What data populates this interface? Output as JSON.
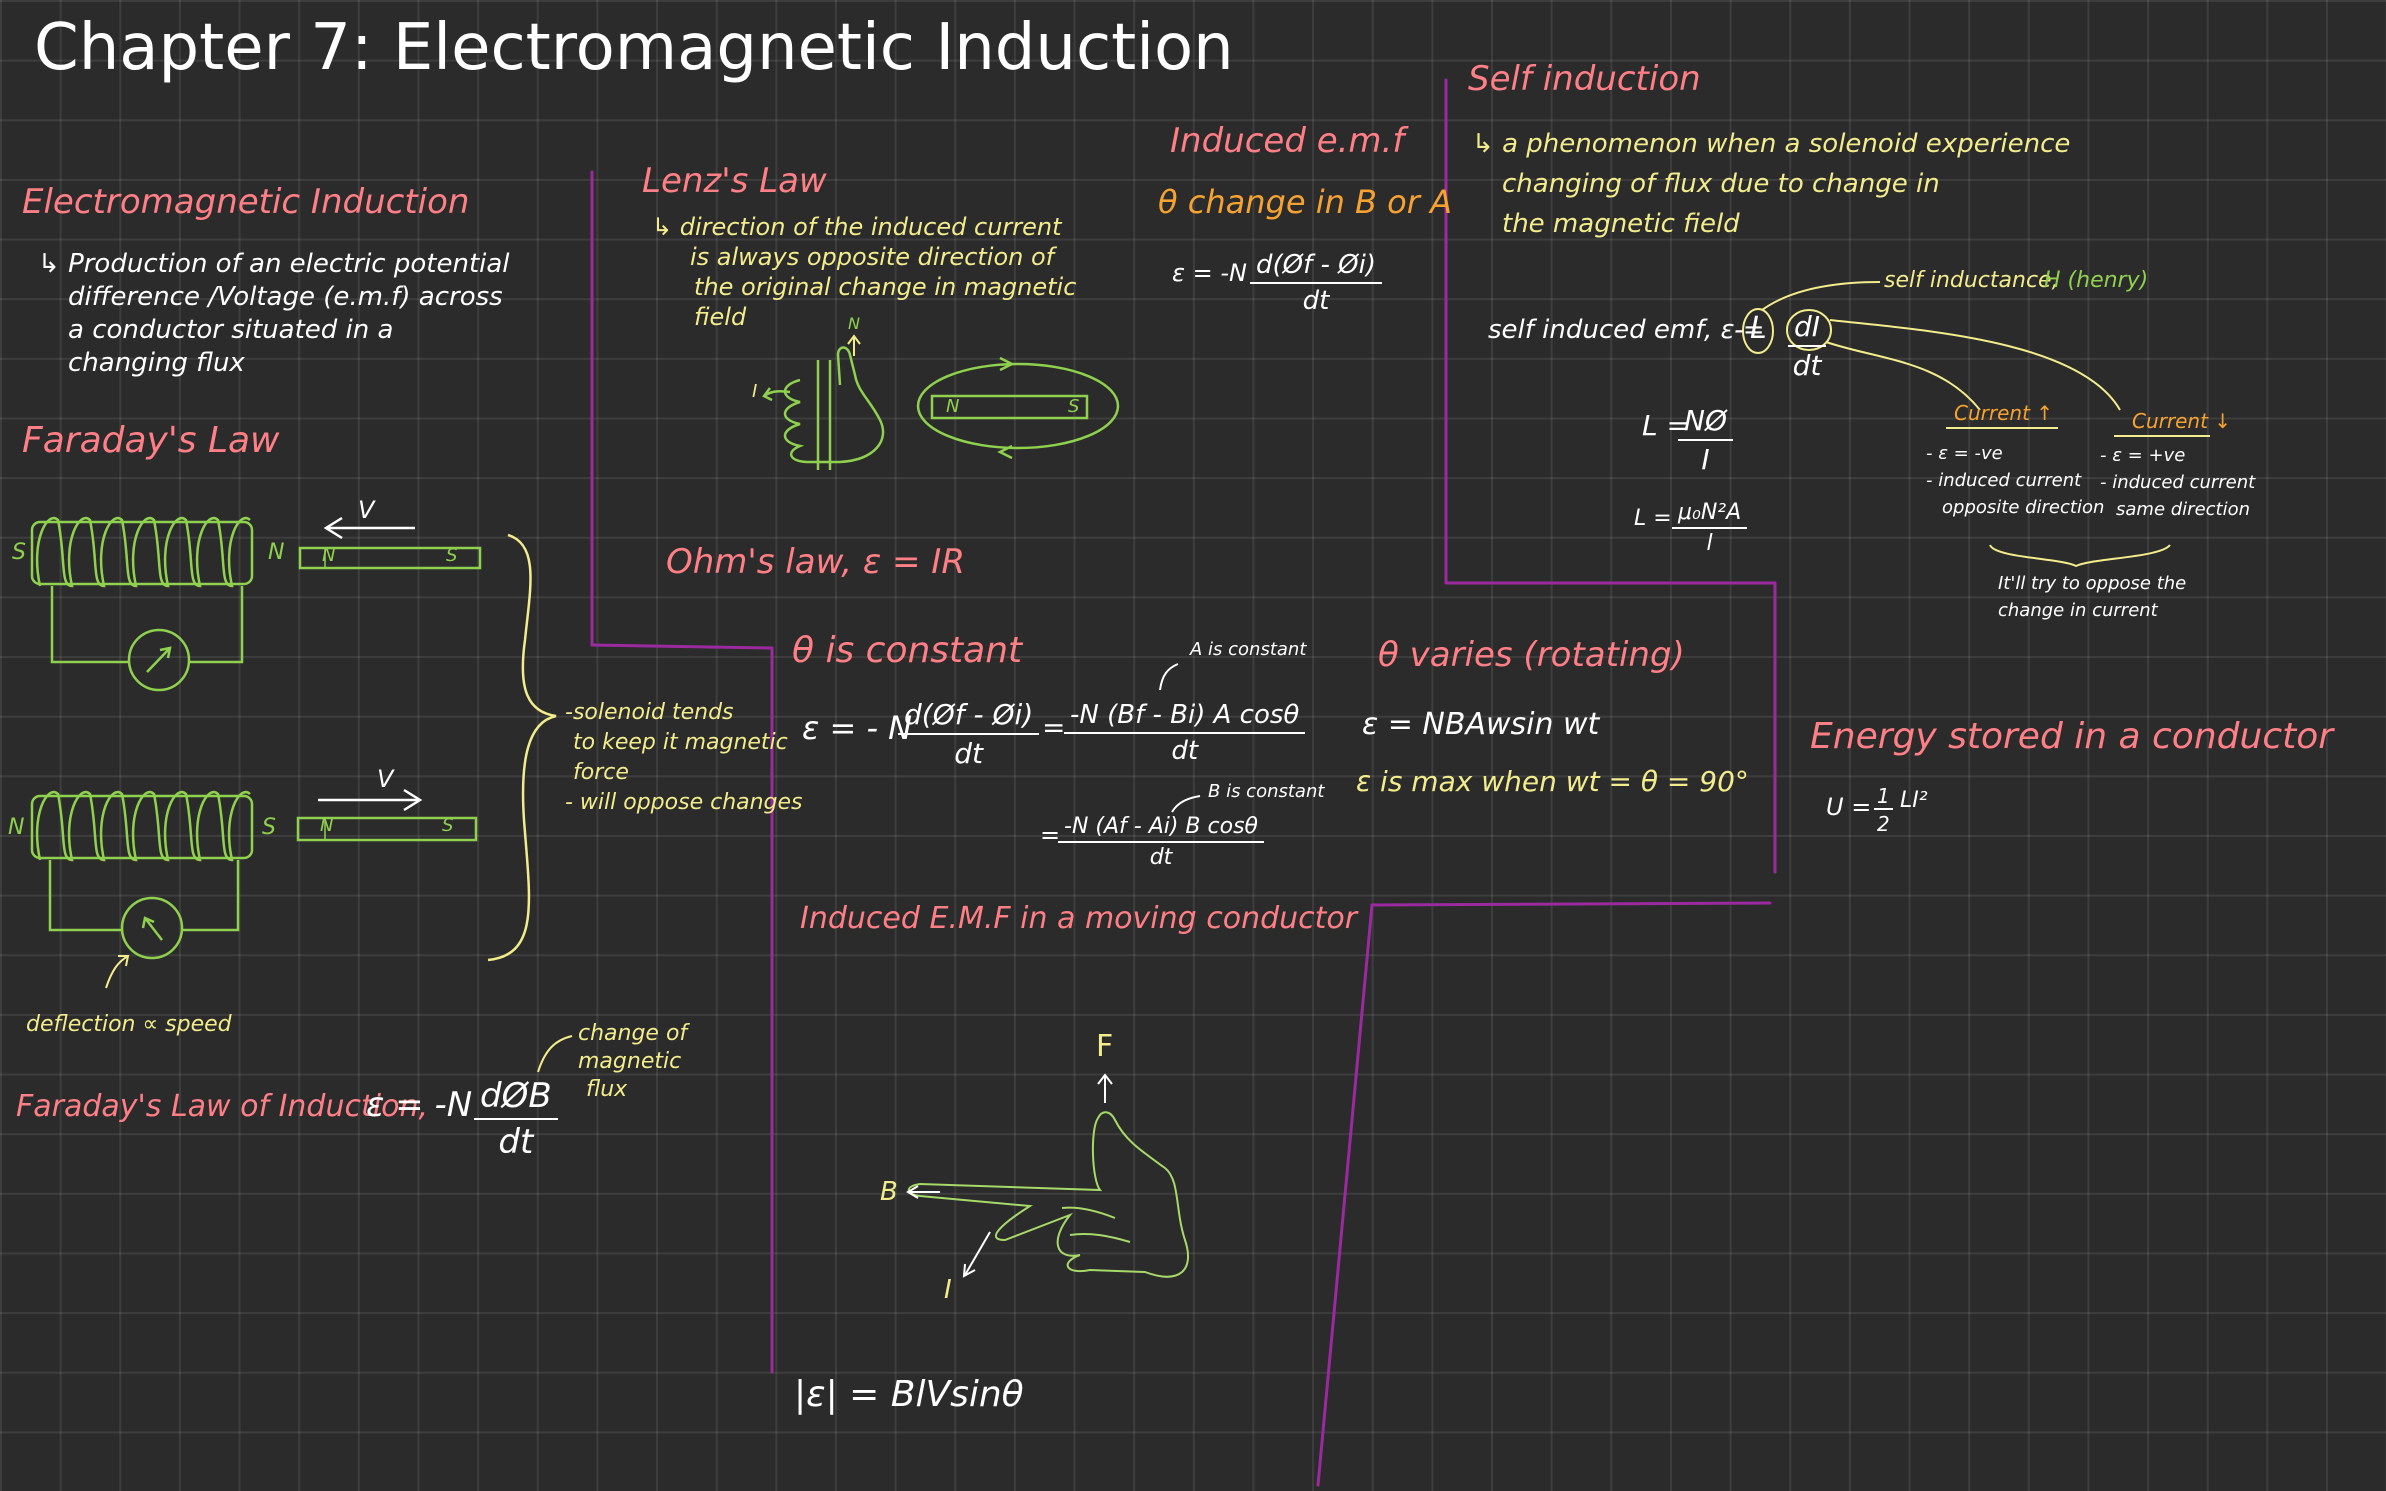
{
  "title": "Chapter 7: Electromagnetic Induction",
  "colors": {
    "background": "#2b2b2b",
    "pink": "#ff7f86",
    "yellow": "#f2ec8c",
    "orange": "#f5a232",
    "green": "#8fd14f",
    "purple": "#9b2a9e"
  },
  "em_induction": {
    "heading": "Electromagnetic Induction",
    "lines": [
      "Production of an electric potential",
      "difference /Voltage (e.m.f) across",
      "a conductor  situated  in a",
      "changing  flux"
    ]
  },
  "faraday": {
    "heading": "Faraday's  Law",
    "pole_s": "S",
    "pole_n": "N",
    "v_label": "V",
    "bar_n": "N",
    "bar_s": "S",
    "deflection_note": "deflection  ∝ speed",
    "brace_notes": [
      "-solenoid  tends",
      "to keep it magnetic",
      "force",
      "- will  oppose  changes"
    ],
    "law_label": "Faraday's  Law of  Induction,",
    "law_lhs": "ε = -N",
    "law_num": "dØB",
    "law_den": "dt",
    "flux_note": [
      "change of",
      "magnetic",
      "flux"
    ]
  },
  "lenz": {
    "heading": "Lenz's Law",
    "lines": [
      "direction  of the induced current",
      "is always  opposite  direction  of",
      "the  original   change   in  magnetic",
      "field"
    ],
    "i_label": "I",
    "n_label": "N",
    "bar_n": "N",
    "bar_s": "S"
  },
  "ohm": {
    "text": "Ohm's  law,  ε = IR"
  },
  "theta_constant": {
    "heading": "θ is constant",
    "eq1_lhs": "ε = - N",
    "eq1_num": "d(Øf - Øi)",
    "eq1_den": "dt",
    "eq2_prefix": "=",
    "eq2_num": "-N (Bf - Bi) A cosθ",
    "eq2_den": "dt",
    "a_const_note": "A is constant",
    "b_const_note": "B is constant",
    "eq3_prefix": "=",
    "eq3_num": "-N (Af - Ai) B cosθ",
    "eq3_den": "dt"
  },
  "induced_emf": {
    "heading": "Induced  e.m.f",
    "subheading": "θ change in  B or A",
    "eq_lhs": "ε = -N",
    "eq_num": "d(Øf - Øi)",
    "eq_den": "dt"
  },
  "theta_varies": {
    "heading": "θ varies (rotating)",
    "eq": "ε = NBAwsin wt",
    "max_note": "ε is max  when  wt = θ = 90°"
  },
  "moving_conductor": {
    "heading": "Induced  E.M.F  in a moving  conductor",
    "f_label": "F",
    "b_label": "B",
    "i_label": "I",
    "formula": "|ε| = BlVsinθ"
  },
  "self_induction": {
    "heading": "Self induction",
    "lines": [
      "a phenomenon when a solenoid  experience",
      "changing  of flux due  to change in",
      "the  magnetic  field"
    ],
    "emf_label": "self induced  emf,  ε =",
    "emf_minus": "-",
    "emf_l": "L",
    "emf_num": "dI",
    "emf_den": "dt",
    "inductance_note": "self inductance,",
    "henry_note": "H (henry)",
    "l1_lhs": "L =",
    "l1_num": "NØ",
    "l1_den": "I",
    "l2_lhs": "L =",
    "l2_num": "μ₀N²A",
    "l2_den": "l",
    "current_up": "Current ↑",
    "current_down": "Current ↓",
    "up_notes": [
      "- ε = -ve",
      "- induced current",
      "opposite direction"
    ],
    "down_notes": [
      "- ε = +ve",
      "- induced current",
      "same  direction"
    ],
    "oppose_note": [
      "It'll  try  to  oppose  the",
      "change  in  current"
    ]
  },
  "energy": {
    "heading": "Energy  stored  in a conductor",
    "eq_lhs": "U =",
    "eq_num": "1",
    "eq_den": "2",
    "eq_rhs": "LI²"
  }
}
